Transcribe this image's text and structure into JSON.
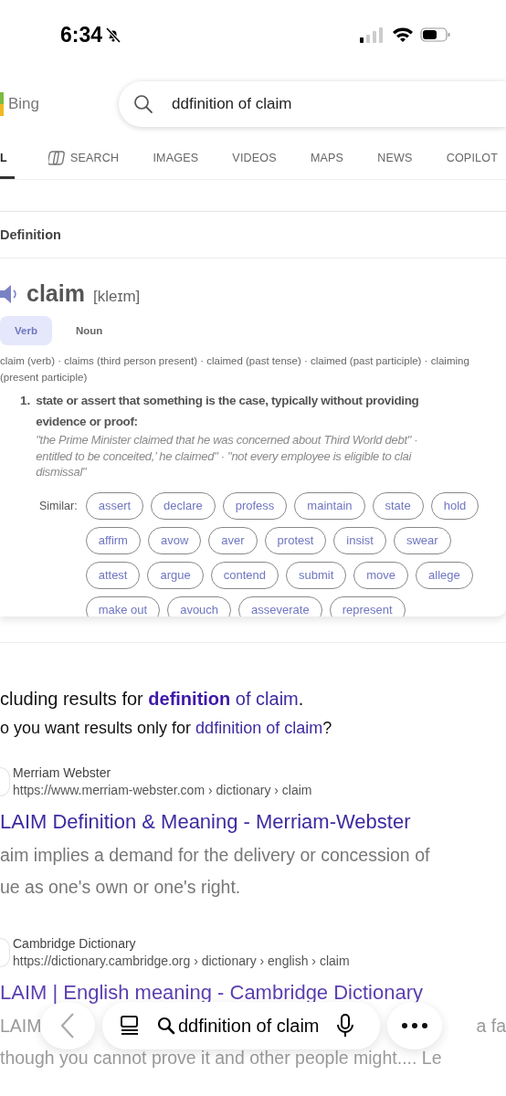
{
  "status_bar": {
    "time": "6:34",
    "silent": true
  },
  "header": {
    "logo_text": "Bing",
    "search": {
      "value": "ddfinition of claim"
    }
  },
  "tabs": [
    {
      "label": "L",
      "selected": true,
      "kind": "plain"
    },
    {
      "label": "SEARCH",
      "selected": false,
      "kind": "icon"
    },
    {
      "label": "IMAGES",
      "selected": false,
      "kind": "plain"
    },
    {
      "label": "VIDEOS",
      "selected": false,
      "kind": "plain"
    },
    {
      "label": "MAPS",
      "selected": false,
      "kind": "plain"
    },
    {
      "label": "NEWS",
      "selected": false,
      "kind": "plain"
    },
    {
      "label": "COPILOT",
      "selected": false,
      "kind": "plain"
    }
  ],
  "definition_card": {
    "heading": "Definition",
    "word": "claim",
    "pronunciation": "[kleɪm]",
    "pos_tabs": [
      {
        "label": "Verb",
        "selected": true
      },
      {
        "label": "Noun",
        "selected": false
      }
    ],
    "forms": "claim (verb) · claims (third person present) · claimed (past tense) · claimed (past participle) · claiming (present participle)",
    "sense": {
      "number": "1.",
      "text_lines": [
        "state or assert that something is the case, typically without providing",
        "evidence or proof:"
      ],
      "example_lines": [
        "\"the Prime Minister claimed that he was concerned about Third World debt\" ·",
        "entitled to be conceited,’ he claimed\" · \"not every employee is eligible to clai",
        "dismissal\""
      ]
    },
    "similar_label": "Similar:",
    "similar": [
      [
        "assert",
        "declare",
        "profess",
        "maintain",
        "state",
        "hold"
      ],
      [
        "affirm",
        "avow",
        "aver",
        "protest",
        "insist",
        "swear"
      ],
      [
        "attest",
        "argue",
        "contend",
        "submit",
        "move",
        "allege"
      ],
      [
        "make out",
        "avouch",
        "asseverate",
        "represent"
      ]
    ]
  },
  "spelling": {
    "line_1": {
      "prefix": "cluding results for ",
      "link": "**definition** of claim",
      "suffix": "."
    },
    "line_2": {
      "prefix": "o you want results only for ",
      "link": "ddfinition of claim",
      "suffix": "?"
    }
  },
  "results": [
    {
      "site": "Merriam Webster",
      "url": "https://www.merriam-webster.com › dictionary › claim",
      "title": "LAIM Definition & Meaning - Merriam-Webster",
      "snippet_lines": [
        [
          "aim implies a demand for the delivery or concession of"
        ],
        [
          "ue as one's own or one's right."
        ]
      ]
    },
    {
      "site": "Cambridge Dictionary",
      "url": "https://dictionary.cambridge.org › dictionary › english › claim",
      "title": "LAIM | English meaning - Cambridge Dictionary",
      "snippet_lines": [
        [
          "LAIM",
          "a fa"
        ],
        [
          "though you cannot prove it and other people might.... Le"
        ]
      ]
    }
  ],
  "toolbar": {
    "query": "ddfinition of claim"
  }
}
